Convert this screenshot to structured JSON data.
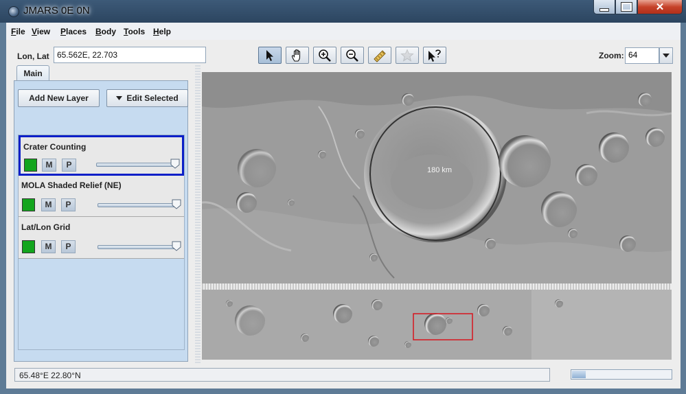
{
  "window": {
    "title": "JMARS 0E 0N"
  },
  "menu": [
    "File",
    "View",
    "Places",
    "Body",
    "Tools",
    "Help"
  ],
  "location": {
    "label": "Lon, Lat",
    "value": "65.562E, 22.703"
  },
  "toolbar": {
    "tools": [
      "select-pointer-icon",
      "pan-hand-icon",
      "zoom-in-icon",
      "zoom-out-icon",
      "ruler-icon",
      "star-icon",
      "investigate-pointer-icon"
    ],
    "zoom_label": "Zoom:",
    "zoom_value": "64"
  },
  "panel": {
    "tab": "Main",
    "add_layer": "Add New Layer",
    "edit_selected": "Edit Selected",
    "layers": [
      {
        "name": "Crater Counting",
        "m": "M",
        "p": "P",
        "color": "#13a51d",
        "opacity": 1.0,
        "selected": true
      },
      {
        "name": "MOLA Shaded Relief (NE)",
        "m": "M",
        "p": "P",
        "color": "#13a51d",
        "opacity": 1.0,
        "selected": false
      },
      {
        "name": "Lat/Lon Grid",
        "m": "M",
        "p": "P",
        "color": "#13a51d",
        "opacity": 1.0,
        "selected": false
      }
    ]
  },
  "map": {
    "crater_label": "180 km"
  },
  "status": {
    "coords": "65.48°E   22.80°N",
    "progress": 0.14
  }
}
